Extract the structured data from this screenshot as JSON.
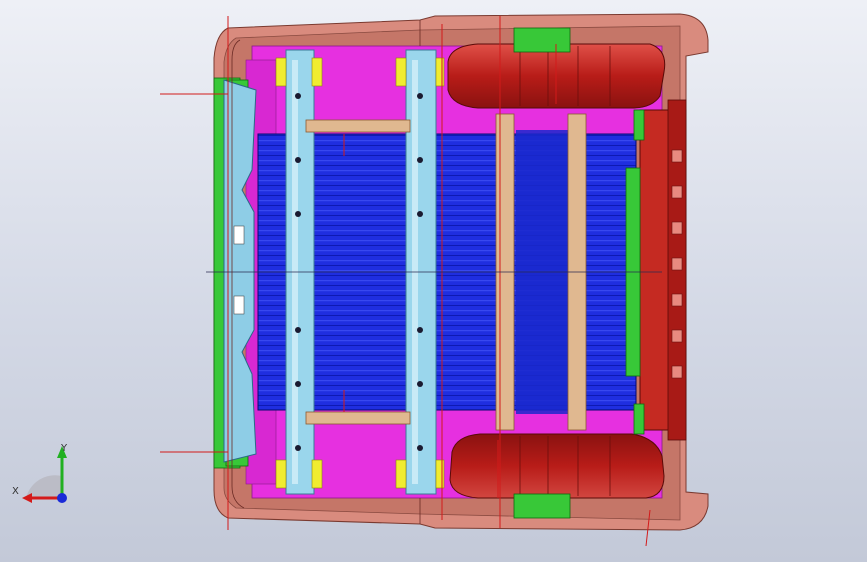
{
  "viewport": {
    "background_top": "#eef0f6",
    "background_bottom": "#c3c9d8"
  },
  "model": {
    "colors": {
      "body_shell": "#d98b7e",
      "shell_shade": "#b86a5e",
      "floor_blue": "#1f2ee0",
      "floor_dark": "#0a14a8",
      "magenta_panel": "#e630e0",
      "cross_member": "#8ecde6",
      "cross_member_dark": "#4a8aa8",
      "wheelhouse": "#c0201c",
      "rear_panel": "#c52a22",
      "green_bracket": "#38c838",
      "tan_rib": "#e0b890",
      "section_line": "#d21a1a",
      "yellow_pad": "#f0ec30"
    }
  },
  "triad": {
    "x_label": "X",
    "y_label": "Y",
    "x_color": "#d41a1a",
    "y_color": "#21b021",
    "z_color": "#1a2ad8"
  }
}
